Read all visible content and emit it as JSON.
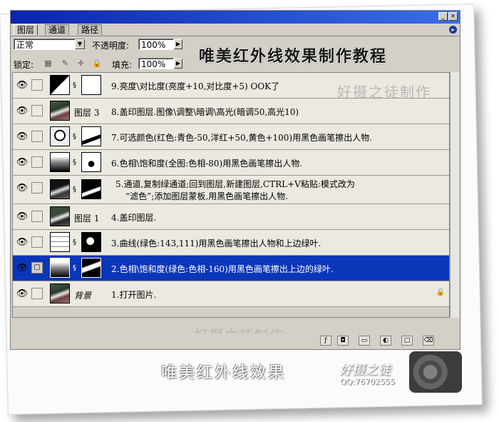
{
  "palette": {
    "tabs": [
      "图层",
      "通道",
      "路径"
    ],
    "blend_mode": "正常",
    "opacity_label": "不透明度:",
    "opacity_value": "100%",
    "lock_label": "锁定:",
    "fill_label": "填充:",
    "fill_value": "100%",
    "title_overlay": "唯美红外线效果制作教程"
  },
  "layers": [
    {
      "name": "",
      "desc": "9.亮度\\对比度(亮度+10,对比度+5) OOK了",
      "selected": false
    },
    {
      "name": "图层 3",
      "desc": "8.盖印图层.图像\\调整\\暗调\\高光(暗调50,高光10)",
      "selected": false
    },
    {
      "name": "",
      "desc": "7.可选颜色(红色:青色-50,洋红+50,黄色+100)用黑色画笔擦出人物.",
      "selected": false
    },
    {
      "name": "",
      "desc": "6.色相\\饱和度(全图:色相-80)用黑色画笔擦出人物.",
      "selected": false
    },
    {
      "name": "",
      "desc": "5.通道,复制绿通道;回到图层,新建图层,CTRL+V粘贴:模式改为",
      "desc2": "“滤色”;添加图层蒙板,用黑色画笔擦出人物.",
      "selected": false
    },
    {
      "name": "图层 1",
      "desc": "4.盖印图层.",
      "selected": false
    },
    {
      "name": "",
      "desc": "3.曲线(绿色:143,111)用黑色画笔擦出人物和上边绿叶.",
      "selected": false
    },
    {
      "name": "",
      "desc": "2.色相\\饱和度(绿色:色相-160)用黑色画笔擦出上边的绿叶.",
      "selected": true
    },
    {
      "name": "背景",
      "desc": "1.打开图片.",
      "selected": false
    }
  ],
  "watermarks": {
    "top_right": "好摄之徒制作",
    "bottom": "好摄之徒制作"
  },
  "footer": {
    "caption": "唯美红外线效果",
    "logo": "好摄之徒",
    "qq": "QQ:76702555"
  },
  "icons": {
    "eye": "eye-icon",
    "chain": "link-icon",
    "lock": "lock-icon"
  },
  "colors": {
    "selection": "#0a36b8",
    "panel": "#d4d0c8",
    "titlebar": "#0a24b0"
  }
}
